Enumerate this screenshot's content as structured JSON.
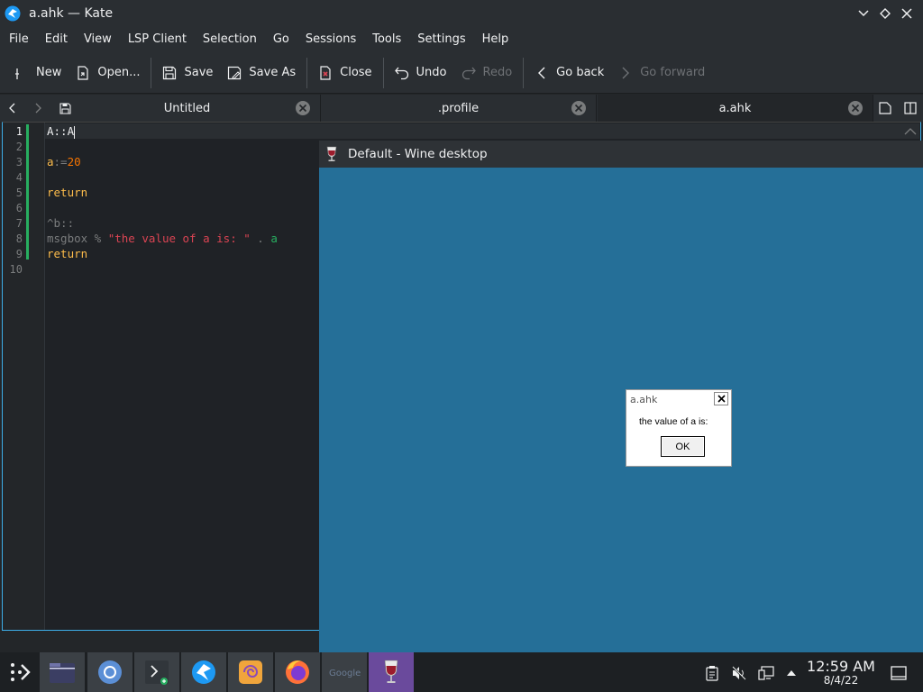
{
  "window": {
    "title": "a.ahk — Kate"
  },
  "menu": [
    "File",
    "Edit",
    "View",
    "LSP Client",
    "Selection",
    "Go",
    "Sessions",
    "Tools",
    "Settings",
    "Help"
  ],
  "toolbar": {
    "new": "New",
    "open": "Open...",
    "save": "Save",
    "save_as": "Save As",
    "close": "Close",
    "undo": "Undo",
    "redo": "Redo",
    "go_back": "Go back",
    "go_forward": "Go forward"
  },
  "tabs": [
    {
      "label": "Untitled",
      "active": false
    },
    {
      "label": ".profile",
      "active": false
    },
    {
      "label": "a.ahk",
      "active": true
    }
  ],
  "editor": {
    "line_numbers": [
      "1",
      "2",
      "3",
      "4",
      "5",
      "6",
      "7",
      "8",
      "9",
      "10"
    ],
    "lines": {
      "l1": "A::A",
      "l3_var": "a",
      "l3_op": ":=",
      "l3_num": "20",
      "l5": "return",
      "l7": "^b::",
      "l8_cmd": "msgbox",
      "l8_pct": " % ",
      "l8_str": "\"the value of a is: \"",
      "l8_dot": " . ",
      "l8_var": "a",
      "l9": "return"
    }
  },
  "wine": {
    "title": "Default - Wine desktop",
    "msgbox": {
      "title": "a.ahk",
      "text": "the value of a is:",
      "ok": "OK"
    }
  },
  "taskbar": {
    "time": "12:59 AM",
    "date": "8/4/22"
  },
  "colors": {
    "wine_desktop": "#256f98",
    "accent": "#3daee9",
    "taskbar_highlight": "#6a4a9c"
  }
}
